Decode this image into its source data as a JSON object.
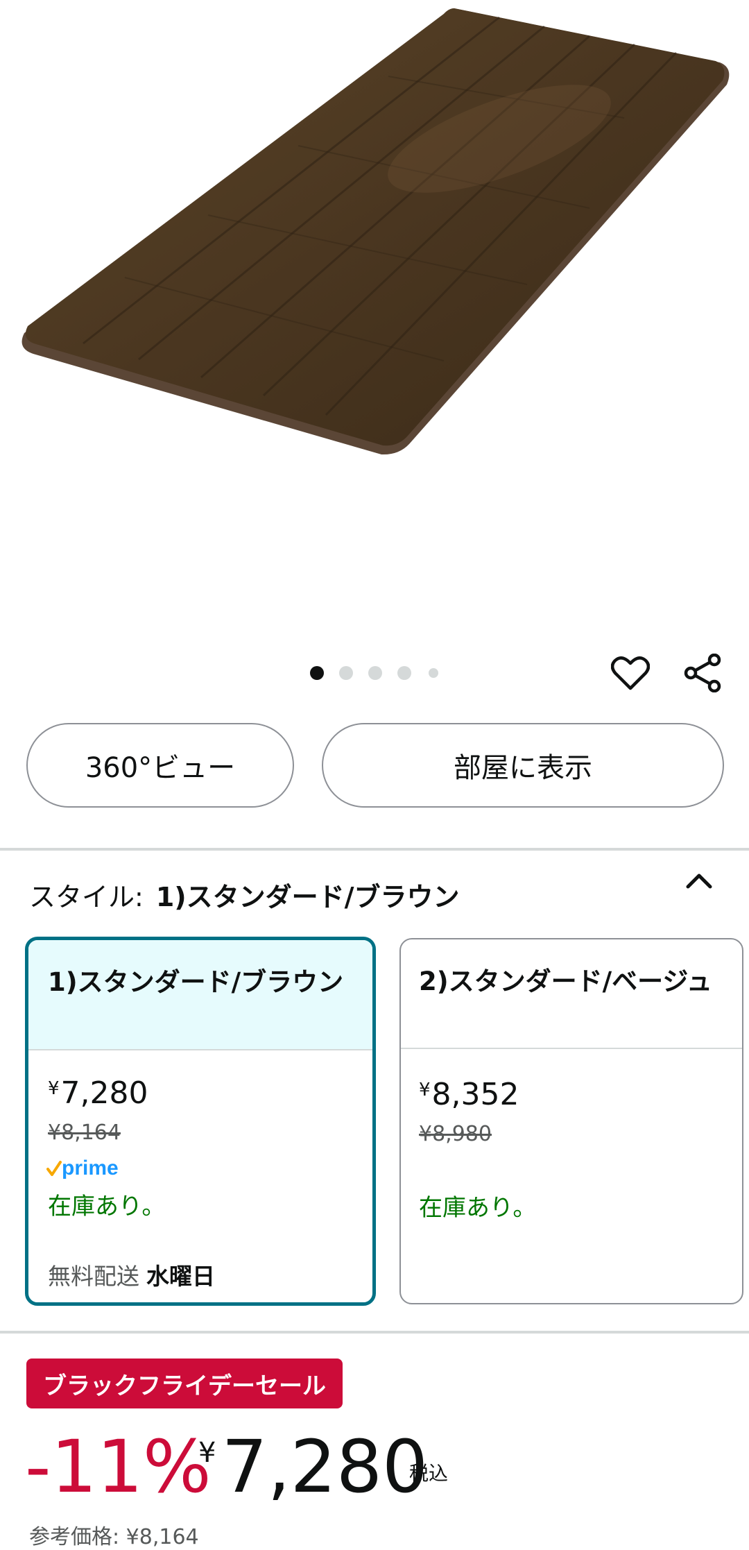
{
  "carousel": {
    "total_dots": 5,
    "active_index": 0
  },
  "icons": {
    "favorite": "heart-icon",
    "share": "share-icon",
    "collapse": "chevron-up-icon",
    "prime_check": "check-icon"
  },
  "view_buttons": {
    "view360": "360°ビュー",
    "view_in_room": "部屋に表示"
  },
  "style_selector": {
    "label": "スタイル:",
    "selected_value": "1)スタンダード/ブラウン",
    "options": [
      {
        "name": "1)スタンダード/ブラウン",
        "yen": "¥",
        "price": "7,280",
        "list_price": "¥8,164",
        "prime": "prime",
        "stock": "在庫あり。",
        "shipping_label": "無料配送",
        "shipping_day": "水曜日",
        "selected": true
      },
      {
        "name": "2)スタンダード/ベージュ",
        "yen": "¥",
        "price": "8,352",
        "list_price": "¥8,980",
        "stock": "在庫あり。",
        "selected": false
      }
    ]
  },
  "deal": {
    "badge": "ブラックフライデーセール",
    "discount": "-11%",
    "yen": "¥",
    "price": "7,280",
    "tax_label": "税込",
    "ref_price": "参考価格: ¥8,164"
  },
  "colors": {
    "selected_border": "#007185",
    "selected_header_bg": "#e6fbfd",
    "deal_red": "#cc0c39",
    "in_stock_green": "#007600",
    "prime_blue": "#1a98ff",
    "prime_check_orange": "#f7a800"
  }
}
